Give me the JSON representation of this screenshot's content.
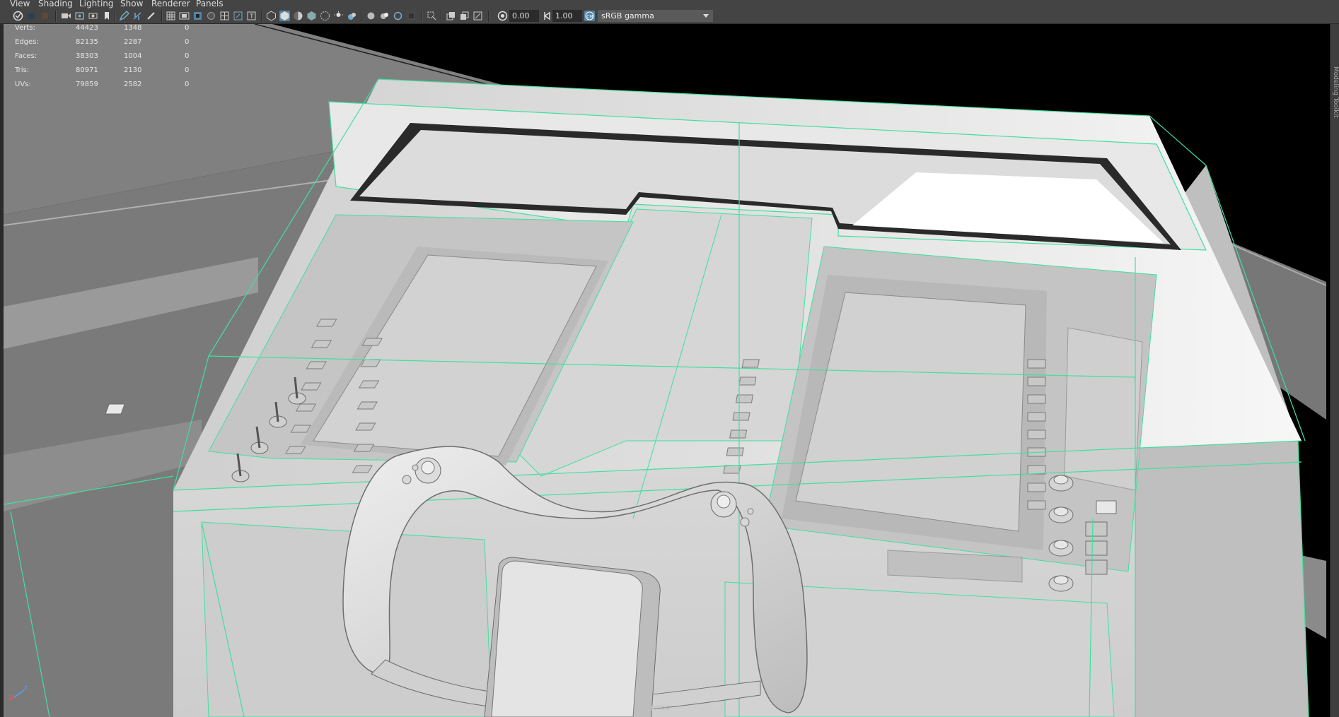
{
  "menubar": {
    "items": [
      "View",
      "Shading",
      "Lighting",
      "Show",
      "Renderer",
      "Panels"
    ]
  },
  "toolbar": {
    "icons": [
      "select-camera-icon",
      "camera-attributes-icon",
      "bookmarks-icon",
      "image-plane-icon",
      "camera-icon",
      "view-2d-icon",
      "grease-pencil-icon",
      "grid-icon",
      "film-gate-icon",
      "resolution-gate-icon",
      "gate-mask-icon",
      "field-chart-icon",
      "safe-action-icon",
      "safe-title-icon",
      "wireframe-icon",
      "smooth-shade-icon",
      "default-lighting-icon",
      "textured-icon",
      "use-all-lights-icon",
      "shadows-icon",
      "screen-space-ao-icon",
      "motion-blur-icon",
      "multisample-aa-icon",
      "depth-of-field-icon",
      "isolate-select-icon",
      "xray-icon",
      "xray-joints-icon",
      "xray-active-icon",
      "exposure-icon",
      "gamma-icon",
      "view-transform-icon"
    ],
    "exposure_value": "0.00",
    "gamma_value": "1.00",
    "colorspace_label": "sRGB gamma",
    "accent": "#5285a6"
  },
  "hud": {
    "rows": [
      {
        "label": "Verts:",
        "total": "44423",
        "selected": "1348",
        "components": "0"
      },
      {
        "label": "Edges:",
        "total": "82135",
        "selected": "2287",
        "components": "0"
      },
      {
        "label": "Faces:",
        "total": "38303",
        "selected": "1004",
        "components": "0"
      },
      {
        "label": "Tris:",
        "total": "80971",
        "selected": "2130",
        "components": "0"
      },
      {
        "label": "UVs:",
        "total": "79859",
        "selected": "2582",
        "components": "0"
      }
    ]
  },
  "viewport": {
    "camera_label": "persp",
    "axis_labels": {
      "x": "x",
      "z": "z"
    },
    "wire_color": "#40e0a0",
    "shade_light": "#e4e4e4",
    "shade_mid": "#c8c8c8",
    "shade_dark": "#9a9a9a"
  },
  "right_strip": {
    "tab_text": "Modeling Toolkit"
  }
}
